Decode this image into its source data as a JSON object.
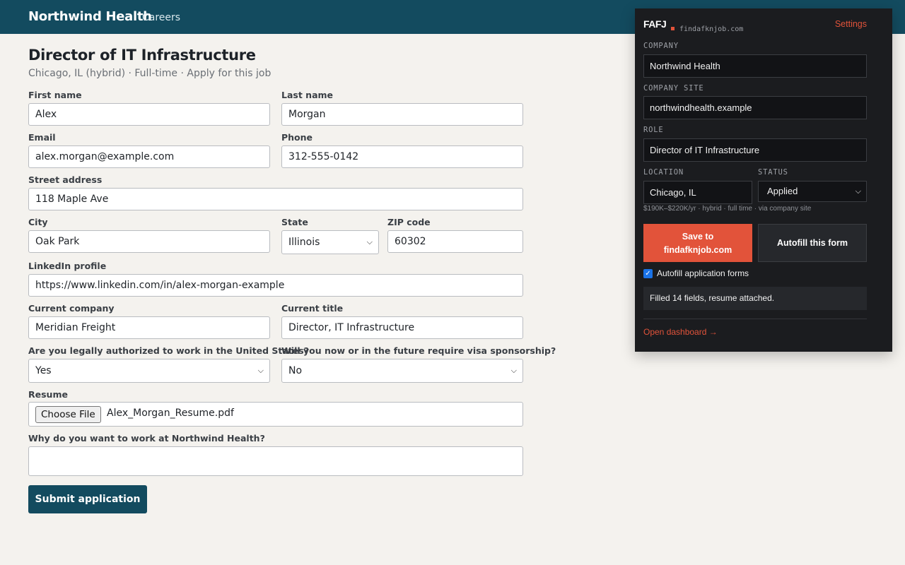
{
  "header": {
    "brand": "Northwind Health",
    "nav_link": "Careers"
  },
  "job": {
    "title": "Director of IT Infrastructure",
    "subtitle": "Chicago, IL (hybrid) · Full-time · Apply for this job"
  },
  "form": {
    "first_name": {
      "label": "First name",
      "value": "Alex"
    },
    "last_name": {
      "label": "Last name",
      "value": "Morgan"
    },
    "email": {
      "label": "Email",
      "value": "alex.morgan@example.com"
    },
    "phone": {
      "label": "Phone",
      "value": "312-555-0142"
    },
    "street": {
      "label": "Street address",
      "value": "118 Maple Ave"
    },
    "city": {
      "label": "City",
      "value": "Oak Park"
    },
    "state": {
      "label": "State",
      "value": "Illinois"
    },
    "zip": {
      "label": "ZIP code",
      "value": "60302"
    },
    "linkedin": {
      "label": "LinkedIn profile",
      "value": "https://www.linkedin.com/in/alex-morgan-example"
    },
    "current_company": {
      "label": "Current company",
      "value": "Meridian Freight"
    },
    "current_title": {
      "label": "Current title",
      "value": "Director, IT Infrastructure"
    },
    "work_auth": {
      "label": "Are you legally authorized to work in the United States?",
      "value": "Yes"
    },
    "visa": {
      "label": "Will you now or in the future require visa sponsorship?",
      "value": "No"
    },
    "resume": {
      "label": "Resume",
      "button": "Choose File",
      "filename": "Alex_Morgan_Resume.pdf"
    },
    "why": {
      "label": "Why do you want to work at Northwind Health?",
      "value": ""
    },
    "submit_label": "Submit application"
  },
  "extension": {
    "logo": "FAFJ",
    "site": "findafknjob.com",
    "settings_label": "Settings",
    "company": {
      "label": "COMPANY",
      "value": "Northwind Health"
    },
    "company_site": {
      "label": "COMPANY SITE",
      "value": "northwindhealth.example"
    },
    "role": {
      "label": "ROLE",
      "value": "Director of IT Infrastructure"
    },
    "location": {
      "label": "LOCATION",
      "value": "Chicago, IL"
    },
    "status": {
      "label": "STATUS",
      "value": "Applied"
    },
    "meta": "$190K–$220K/yr · hybrid · full time · via company site",
    "save_label_line1": "Save to",
    "save_label_line2": "findafknjob.com",
    "autofill_label": "Autofill this form",
    "autofill_checkbox_label": "Autofill application forms",
    "autofill_checked": true,
    "status_message": "Filled 14 fields, resume attached.",
    "dashboard_link": "Open dashboard →",
    "accent_color": "#e2533a"
  }
}
